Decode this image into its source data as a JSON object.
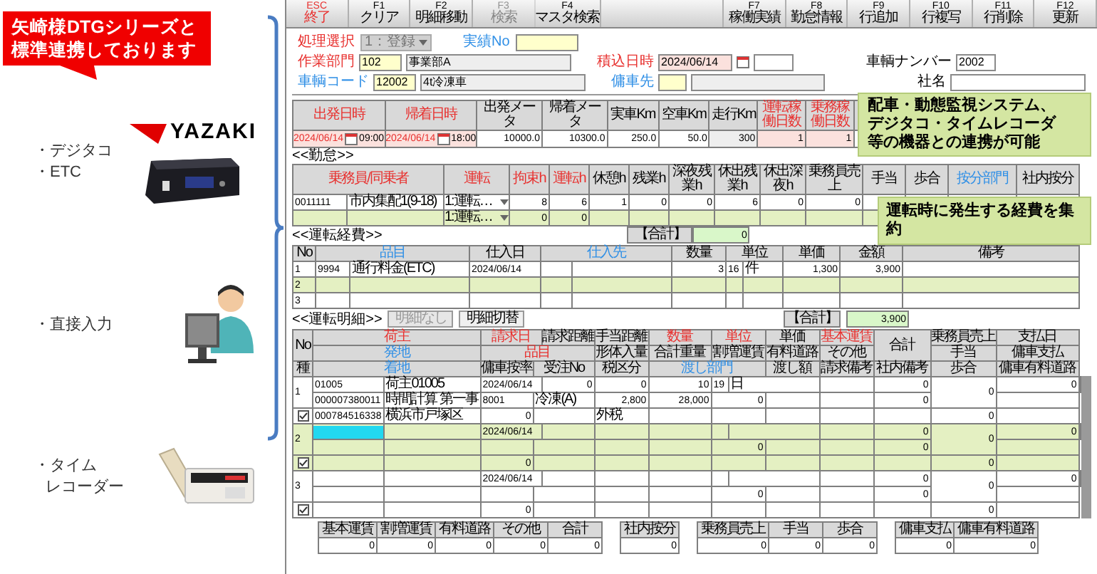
{
  "intro": {
    "callout": "矢崎様DTGシリーズと標準連携しております",
    "brand": "YAZAKI",
    "sources": [
      {
        "kind": "dtg",
        "labels": [
          "・デジタコ",
          "・ETC"
        ]
      },
      {
        "kind": "manual",
        "labels": [
          "・直接入力"
        ]
      },
      {
        "kind": "recorder",
        "labels": [
          "・タイム",
          "レコーダー"
        ]
      }
    ]
  },
  "keys_left": [
    {
      "key": "ESC",
      "label": "終了",
      "kind": "exit",
      "disabled": false
    },
    {
      "key": "F1",
      "label": "クリア",
      "kind": "normal",
      "disabled": false
    },
    {
      "key": "F2",
      "label": "明細移動",
      "kind": "normal",
      "disabled": false
    },
    {
      "key": "F3",
      "label": "検索",
      "kind": "normal",
      "disabled": true
    },
    {
      "key": "F4",
      "label": "マスタ検索",
      "kind": "normal",
      "disabled": false
    }
  ],
  "keys_right": [
    {
      "key": "F7",
      "label": "稼働実績",
      "kind": "normal",
      "disabled": false
    },
    {
      "key": "F8",
      "label": "勤怠情報",
      "kind": "normal",
      "disabled": false
    },
    {
      "key": "F9",
      "label": "行追加",
      "kind": "normal",
      "disabled": false
    },
    {
      "key": "F10",
      "label": "行複写",
      "kind": "normal",
      "disabled": false
    },
    {
      "key": "F11",
      "label": "行削除",
      "kind": "normal",
      "disabled": false
    },
    {
      "key": "F12",
      "label": "更新",
      "kind": "normal",
      "disabled": false
    }
  ],
  "form": {
    "process": {
      "label": "処理選択",
      "kind": "required",
      "value": "1：登録",
      "disabled": true
    },
    "record_no": {
      "label": "実績No",
      "kind": "lookup"
    },
    "department": {
      "label": "作業部門",
      "kind": "required",
      "code": "102",
      "name": "事業部A"
    },
    "loading": {
      "label": "積込日時",
      "kind": "required",
      "date": "2024/06/14"
    },
    "plate": {
      "label": "車輌ナンバー",
      "kind": "plain",
      "value": "2002"
    },
    "vehicle": {
      "label": "車輌コード",
      "kind": "lookup",
      "code": "12002",
      "name": "4t冷凍車"
    },
    "charter": {
      "label": "傭車先",
      "kind": "lookup"
    },
    "company": {
      "label": "社名",
      "kind": "plain"
    }
  },
  "callouts": [
    "配車・動態監視システム、デジタコ・タイムレコーダ等の機器との連携が可能",
    "運転時に発生する経費を集約"
  ],
  "trip": {
    "columns": [
      {
        "label": "出発日時",
        "kind": "required"
      },
      {
        "label": "帰着日時",
        "kind": "required"
      },
      {
        "label": "出発メータ",
        "kind": "plain"
      },
      {
        "label": "帰着メータ",
        "kind": "plain"
      },
      {
        "label": "実車Km",
        "kind": "plain"
      },
      {
        "label": "空車Km",
        "kind": "plain"
      },
      {
        "label": "走行Km",
        "kind": "plain"
      },
      {
        "label": "運転稼働日数",
        "kind": "required"
      },
      {
        "label": "乗務稼働日数",
        "kind": "required"
      }
    ],
    "depart_date": "2024/06/14",
    "depart_time": "09:00",
    "return_date": "2024/06/14",
    "return_time": "18:00",
    "values": [
      "10000.0",
      "10300.0",
      "250.0",
      "50.0",
      "300",
      "1",
      "1"
    ]
  },
  "attendance": {
    "title": "<<勤怠>>",
    "columns": [
      {
        "label": "乗務員/同乗者",
        "kind": "required"
      },
      {
        "label": "運転",
        "kind": "required"
      },
      {
        "label": "拘束h",
        "kind": "required"
      },
      {
        "label": "運転h",
        "kind": "required"
      },
      {
        "label": "休憩h",
        "kind": "plain"
      },
      {
        "label": "残業h",
        "kind": "plain"
      },
      {
        "label": "深夜残業h",
        "kind": "plain"
      },
      {
        "label": "休出残業h",
        "kind": "plain"
      },
      {
        "label": "休出深夜h",
        "kind": "plain"
      },
      {
        "label": "乗務員売上",
        "kind": "plain"
      },
      {
        "label": "手当",
        "kind": "plain"
      },
      {
        "label": "歩合",
        "kind": "plain"
      },
      {
        "label": "按分部門",
        "kind": "lookup"
      },
      {
        "label": "社内按分",
        "kind": "plain"
      }
    ],
    "rows": [
      {
        "selected": false,
        "code": "0011111",
        "name": "市内集配1(9-18)",
        "mode": "1:運転…",
        "values": [
          "8",
          "6",
          "1",
          "0",
          "0",
          "6",
          "0",
          "0"
        ]
      },
      {
        "selected": true,
        "mode": "1:運転…",
        "values": [
          "0",
          "0"
        ]
      }
    ],
    "total": {
      "label": "【合計】",
      "value": "0"
    }
  },
  "expenses": {
    "title": "<<運転経費>>",
    "columns": [
      {
        "label": "No",
        "kind": "plain"
      },
      {
        "label": "品目",
        "kind": "lookup"
      },
      {
        "label": "仕入日",
        "kind": "plain"
      },
      {
        "label": "仕入先",
        "kind": "lookup"
      },
      {
        "label": "数量",
        "kind": "plain"
      },
      {
        "label": "単位",
        "kind": "plain"
      },
      {
        "label": "単価",
        "kind": "plain"
      },
      {
        "label": "金額",
        "kind": "plain"
      },
      {
        "label": "備考",
        "kind": "plain"
      }
    ],
    "rows": [
      {
        "no": "1",
        "selected": false,
        "item_code": "9994",
        "item_name": "通行料金(ETC)",
        "date": "2024/06/14",
        "qty": "3",
        "unit_code": "16",
        "unit": "件",
        "price": "1,300",
        "amount": "3,900"
      },
      {
        "no": "2",
        "selected": true
      },
      {
        "no": "3",
        "selected": false
      }
    ],
    "total": {
      "label": "【合計】",
      "value": "3,900"
    }
  },
  "details": {
    "title": "<<運転明細>>",
    "buttons": [
      {
        "label": "明細なし",
        "disabled": true
      },
      {
        "label": "明細切替",
        "disabled": false
      }
    ],
    "header_1": [
      {
        "label": "No",
        "kind": "plain"
      },
      {
        "label": "荷主",
        "kind": "required"
      },
      {
        "label": "請求日",
        "kind": "required"
      },
      {
        "label": "請求距離",
        "kind": "plain"
      },
      {
        "label": "手当距離",
        "kind": "plain"
      },
      {
        "label": "数量",
        "kind": "required"
      },
      {
        "label": "単位",
        "kind": "required"
      },
      {
        "label": "単価",
        "kind": "plain"
      },
      {
        "label": "基本運賃",
        "kind": "required"
      },
      {
        "label": "合計",
        "kind": "plain"
      },
      {
        "label": "乗務員売上",
        "kind": "plain"
      },
      {
        "label": "支払日",
        "kind": "plain"
      }
    ],
    "header_2": [
      {
        "label": "発地",
        "kind": "lookup"
      },
      {
        "label": "品目",
        "kind": "required"
      },
      {
        "label": "形体入量",
        "kind": "plain"
      },
      {
        "label": "合計重量",
        "kind": "plain"
      },
      {
        "label": "割増運賃",
        "kind": "plain"
      },
      {
        "label": "有料道路",
        "kind": "plain"
      },
      {
        "label": "その他",
        "kind": "plain"
      },
      {
        "label": "手当",
        "kind": "plain"
      },
      {
        "label": "傭車支払",
        "kind": "plain"
      }
    ],
    "header_3": [
      {
        "label": "種",
        "kind": "plain"
      },
      {
        "label": "着地",
        "kind": "lookup"
      },
      {
        "label": "傭車按率",
        "kind": "plain"
      },
      {
        "label": "受注No",
        "kind": "plain"
      },
      {
        "label": "税区分",
        "kind": "plain"
      },
      {
        "label": "渡し部門",
        "kind": "lookup"
      },
      {
        "label": "渡し額",
        "kind": "plain"
      },
      {
        "label": "請求備考",
        "kind": "plain"
      },
      {
        "label": "社内備考",
        "kind": "plain"
      },
      {
        "label": "歩合",
        "kind": "plain"
      },
      {
        "label": "傭車有料道路",
        "kind": "plain"
      }
    ],
    "records": [
      {
        "no": "1",
        "selected": false,
        "active": false,
        "checked": true,
        "line1": {
          "code": "01005",
          "name": "荷主01005",
          "date": "2024/06/14",
          "dist": "0",
          "allow": "0",
          "qty": "10",
          "unit_code": "19",
          "unit": "日",
          "base": "0",
          "total": "0",
          "sales": "0"
        },
        "line2": {
          "code": "000007380011",
          "name": "時間計算 第一事",
          "item_code": "8001",
          "item_name": "冷凍(A)",
          "volume": "2,800",
          "weight": "28,000",
          "surcharge": "0",
          "allowance": "0"
        },
        "line3": {
          "code": "000784516338",
          "name": "横浜市戸塚区",
          "rate": "0",
          "tax": "外税",
          "commission": "0"
        }
      },
      {
        "no": "2",
        "selected": true,
        "active": true,
        "checked": true,
        "line1": {
          "date": "2024/06/14",
          "base": "0",
          "total": "0",
          "sales": "0"
        },
        "line2": {
          "surcharge": "0",
          "allowance": "0"
        },
        "line3": {
          "rate": "0",
          "commission": "0"
        }
      },
      {
        "no": "3",
        "selected": false,
        "active": false,
        "checked": true,
        "line1": {
          "date": "2024/06/14",
          "base": "0",
          "total": "0",
          "sales": "0"
        },
        "line2": {
          "surcharge": "0",
          "allowance": "0"
        },
        "line3": {
          "rate": "0",
          "commission": "0"
        }
      }
    ]
  },
  "summary": [
    [
      {
        "label": "基本運賃",
        "value": "0"
      },
      {
        "label": "割増運賃",
        "value": "0"
      },
      {
        "label": "有料道路",
        "value": "0"
      },
      {
        "label": "その他",
        "value": "0"
      },
      {
        "label": "合計",
        "value": "0"
      }
    ],
    [
      {
        "label": "社内按分",
        "value": "0"
      }
    ],
    [
      {
        "label": "乗務員売上",
        "value": "0"
      },
      {
        "label": "手当",
        "value": "0"
      },
      {
        "label": "歩合",
        "value": "0"
      }
    ],
    [
      {
        "label": "傭車支払",
        "value": "0"
      },
      {
        "label": "傭車有料道路",
        "value": "0"
      }
    ]
  ]
}
